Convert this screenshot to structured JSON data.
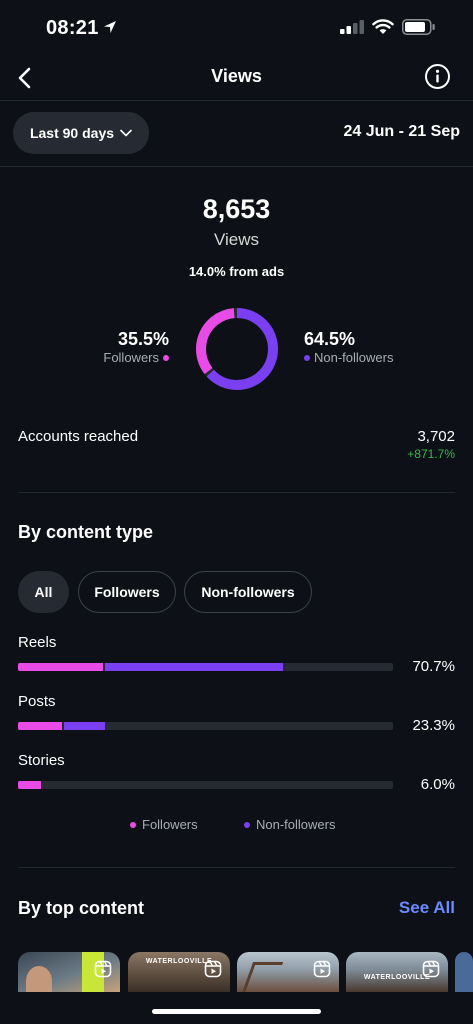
{
  "status": {
    "time": "08:21"
  },
  "header": {
    "title": "Views"
  },
  "filter": {
    "range_label": "Last 90 days",
    "date_range": "24 Jun - 21 Sep"
  },
  "summary": {
    "total": "8,653",
    "label": "Views",
    "ads_note": "14.0% from ads"
  },
  "audience": {
    "followers_pct": "35.5%",
    "followers_label": "Followers",
    "nonfollowers_pct": "64.5%",
    "nonfollowers_label": "Non-followers",
    "followers_fraction": 0.355
  },
  "reach": {
    "label": "Accounts reached",
    "value": "3,702",
    "change": "+871.7%"
  },
  "by_content_type": {
    "title": "By content type",
    "chips": [
      "All",
      "Followers",
      "Non-followers"
    ],
    "active_chip": "All",
    "rows": [
      {
        "label": "Reels",
        "pct": "70.7%",
        "followers": 22.6,
        "nonfollowers": 48.1
      },
      {
        "label": "Posts",
        "pct": "23.3%",
        "followers": 11.7,
        "nonfollowers": 11.6
      },
      {
        "label": "Stories",
        "pct": "6.0%",
        "followers": 6.0,
        "nonfollowers": 0
      }
    ],
    "legend_followers": "Followers",
    "legend_nonfollowers": "Non-followers"
  },
  "by_top_content": {
    "title": "By top content",
    "see_all": "See All",
    "thumb_texts": [
      "",
      "WATERLOOVILLE",
      "",
      "WATERLOOVILLE",
      ""
    ]
  },
  "colors": {
    "followers": "#e94ce6",
    "nonfollowers": "#7b3ff2",
    "positive": "#3bb54a",
    "link": "#6b8cff"
  }
}
